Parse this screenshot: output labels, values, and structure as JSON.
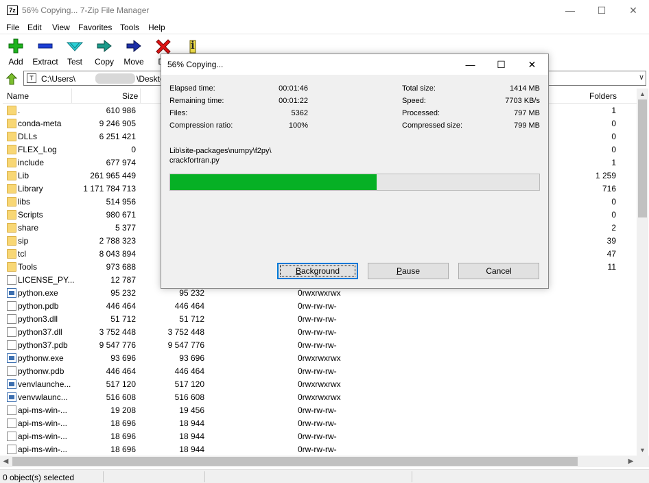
{
  "window": {
    "title": "56% Copying... 7-Zip File Manager",
    "app_icon_text": "7z",
    "minimize": "—",
    "maximize": "☐",
    "close": "✕"
  },
  "menu": [
    "File",
    "Edit",
    "View",
    "Favorites",
    "Tools",
    "Help"
  ],
  "toolbar": {
    "add": "Add",
    "extract": "Extract",
    "test": "Test",
    "copy": "Copy",
    "move": "Move",
    "delete": "De",
    "info_glyph": "i"
  },
  "address": {
    "prefix": "C:\\Users\\",
    "suffix": "\\Desktop\\Ven"
  },
  "columns": {
    "name": "Name",
    "size": "Size",
    "folders": "Folders"
  },
  "rows": [
    {
      "name": ".",
      "size": "610 986",
      "psize": "",
      "attr": "",
      "folders": "1",
      "icon": "folder-icon"
    },
    {
      "name": "conda-meta",
      "size": "9 246 905",
      "psize": "",
      "attr": "",
      "folders": "0",
      "icon": "folder-icon"
    },
    {
      "name": "DLLs",
      "size": "6 251 421",
      "psize": "",
      "attr": "",
      "folders": "0",
      "icon": "folder-icon"
    },
    {
      "name": "FLEX_Log",
      "size": "0",
      "psize": "",
      "attr": "",
      "folders": "0",
      "icon": "folder-icon"
    },
    {
      "name": "include",
      "size": "677 974",
      "psize": "",
      "attr": "",
      "folders": "1",
      "icon": "folder-icon"
    },
    {
      "name": "Lib",
      "size": "261 965 449",
      "psize": "",
      "attr": "",
      "folders": "1 259",
      "icon": "folder-icon"
    },
    {
      "name": "Library",
      "size": "1 171 784 713",
      "psize": "1",
      "attr": "",
      "folders": "716",
      "icon": "folder-icon"
    },
    {
      "name": "libs",
      "size": "514 956",
      "psize": "",
      "attr": "",
      "folders": "0",
      "icon": "folder-icon"
    },
    {
      "name": "Scripts",
      "size": "980 671",
      "psize": "",
      "attr": "",
      "folders": "0",
      "icon": "folder-icon"
    },
    {
      "name": "share",
      "size": "5 377",
      "psize": "",
      "attr": "",
      "folders": "2",
      "icon": "folder-icon"
    },
    {
      "name": "sip",
      "size": "2 788 323",
      "psize": "",
      "attr": "",
      "folders": "39",
      "icon": "folder-icon"
    },
    {
      "name": "tcl",
      "size": "8 043 894",
      "psize": "",
      "attr": "",
      "folders": "47",
      "icon": "folder-icon"
    },
    {
      "name": "Tools",
      "size": "973 688",
      "psize": "",
      "attr": "",
      "folders": "11",
      "icon": "folder-icon"
    },
    {
      "name": "LICENSE_PY...",
      "size": "12 787",
      "psize": "",
      "attr": "",
      "folders": "",
      "icon": "file-icon"
    },
    {
      "name": "python.exe",
      "size": "95 232",
      "psize": "95 232",
      "attr": "0rwxrwxrwx",
      "folders": "",
      "icon": "exe-icon"
    },
    {
      "name": "python.pdb",
      "size": "446 464",
      "psize": "446 464",
      "attr": "0rw-rw-rw-",
      "folders": "",
      "icon": "file-icon"
    },
    {
      "name": "python3.dll",
      "size": "51 712",
      "psize": "51 712",
      "attr": "0rw-rw-rw-",
      "folders": "",
      "icon": "file-icon"
    },
    {
      "name": "python37.dll",
      "size": "3 752 448",
      "psize": "3 752 448",
      "attr": "0rw-rw-rw-",
      "folders": "",
      "icon": "file-icon"
    },
    {
      "name": "python37.pdb",
      "size": "9 547 776",
      "psize": "9 547 776",
      "attr": "0rw-rw-rw-",
      "folders": "",
      "icon": "file-icon"
    },
    {
      "name": "pythonw.exe",
      "size": "93 696",
      "psize": "93 696",
      "attr": "0rwxrwxrwx",
      "folders": "",
      "icon": "exe-icon"
    },
    {
      "name": "pythonw.pdb",
      "size": "446 464",
      "psize": "446 464",
      "attr": "0rw-rw-rw-",
      "folders": "",
      "icon": "file-icon"
    },
    {
      "name": "venvlaunche...",
      "size": "517 120",
      "psize": "517 120",
      "attr": "0rwxrwxrwx",
      "folders": "",
      "icon": "exe-icon"
    },
    {
      "name": "venvwlaunc...",
      "size": "516 608",
      "psize": "516 608",
      "attr": "0rwxrwxrwx",
      "folders": "",
      "icon": "exe-icon"
    },
    {
      "name": "api-ms-win-...",
      "size": "19 208",
      "psize": "19 456",
      "attr": "0rw-rw-rw-",
      "folders": "",
      "icon": "file-icon"
    },
    {
      "name": "api-ms-win-...",
      "size": "18 696",
      "psize": "18 944",
      "attr": "0rw-rw-rw-",
      "folders": "",
      "icon": "file-icon"
    },
    {
      "name": "api-ms-win-...",
      "size": "18 696",
      "psize": "18 944",
      "attr": "0rw-rw-rw-",
      "folders": "",
      "icon": "file-icon"
    },
    {
      "name": "api-ms-win-...",
      "size": "18 696",
      "psize": "18 944",
      "attr": "0rw-rw-rw-",
      "folders": "",
      "icon": "file-icon"
    }
  ],
  "status": {
    "selected": "0 object(s) selected"
  },
  "dialog": {
    "title": "56% Copying...",
    "elapsed_label": "Elapsed time:",
    "elapsed_value": "00:01:46",
    "remaining_label": "Remaining time:",
    "remaining_value": "00:01:22",
    "files_label": "Files:",
    "files_value": "5362",
    "ratio_label": "Compression ratio:",
    "ratio_value": "100%",
    "total_label": "Total size:",
    "total_value": "1414 MB",
    "speed_label": "Speed:",
    "speed_value": "7703 KB/s",
    "processed_label": "Processed:",
    "processed_value": "797 MB",
    "compressed_label": "Compressed size:",
    "compressed_value": "799 MB",
    "current_path": "Lib\\site-packages\\numpy\\f2py\\",
    "current_file": "crackfortran.py",
    "progress_fraction": 0.56,
    "progress_color": "#06b025",
    "background_label_first": "B",
    "background_label_rest": "ackground",
    "pause_label_first": "P",
    "pause_label_rest": "ause",
    "cancel_label": "Cancel"
  }
}
